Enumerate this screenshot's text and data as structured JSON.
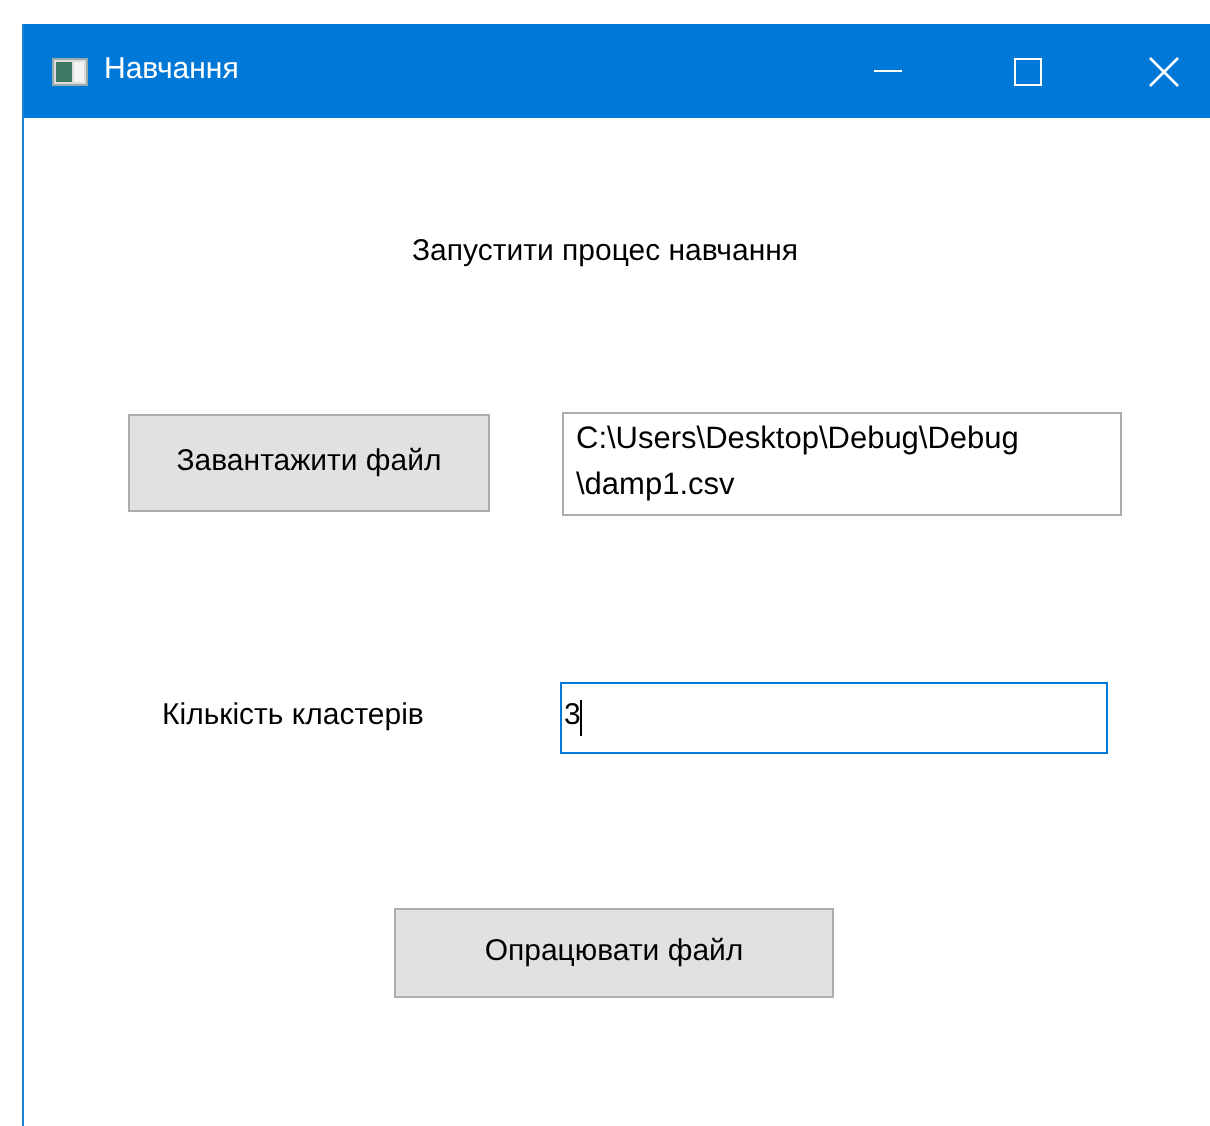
{
  "window": {
    "title": "Навчання"
  },
  "heading": "Запустити процес навчання",
  "load_button": "Завантажити файл",
  "file_path_field": {
    "value": "C:\\Users\\Desktop\\Debug\\Debug\\damp1.csv"
  },
  "clusters": {
    "label": "Кількість кластерів",
    "value": "3",
    "focused": true
  },
  "process_button": "Опрацювати файл"
}
